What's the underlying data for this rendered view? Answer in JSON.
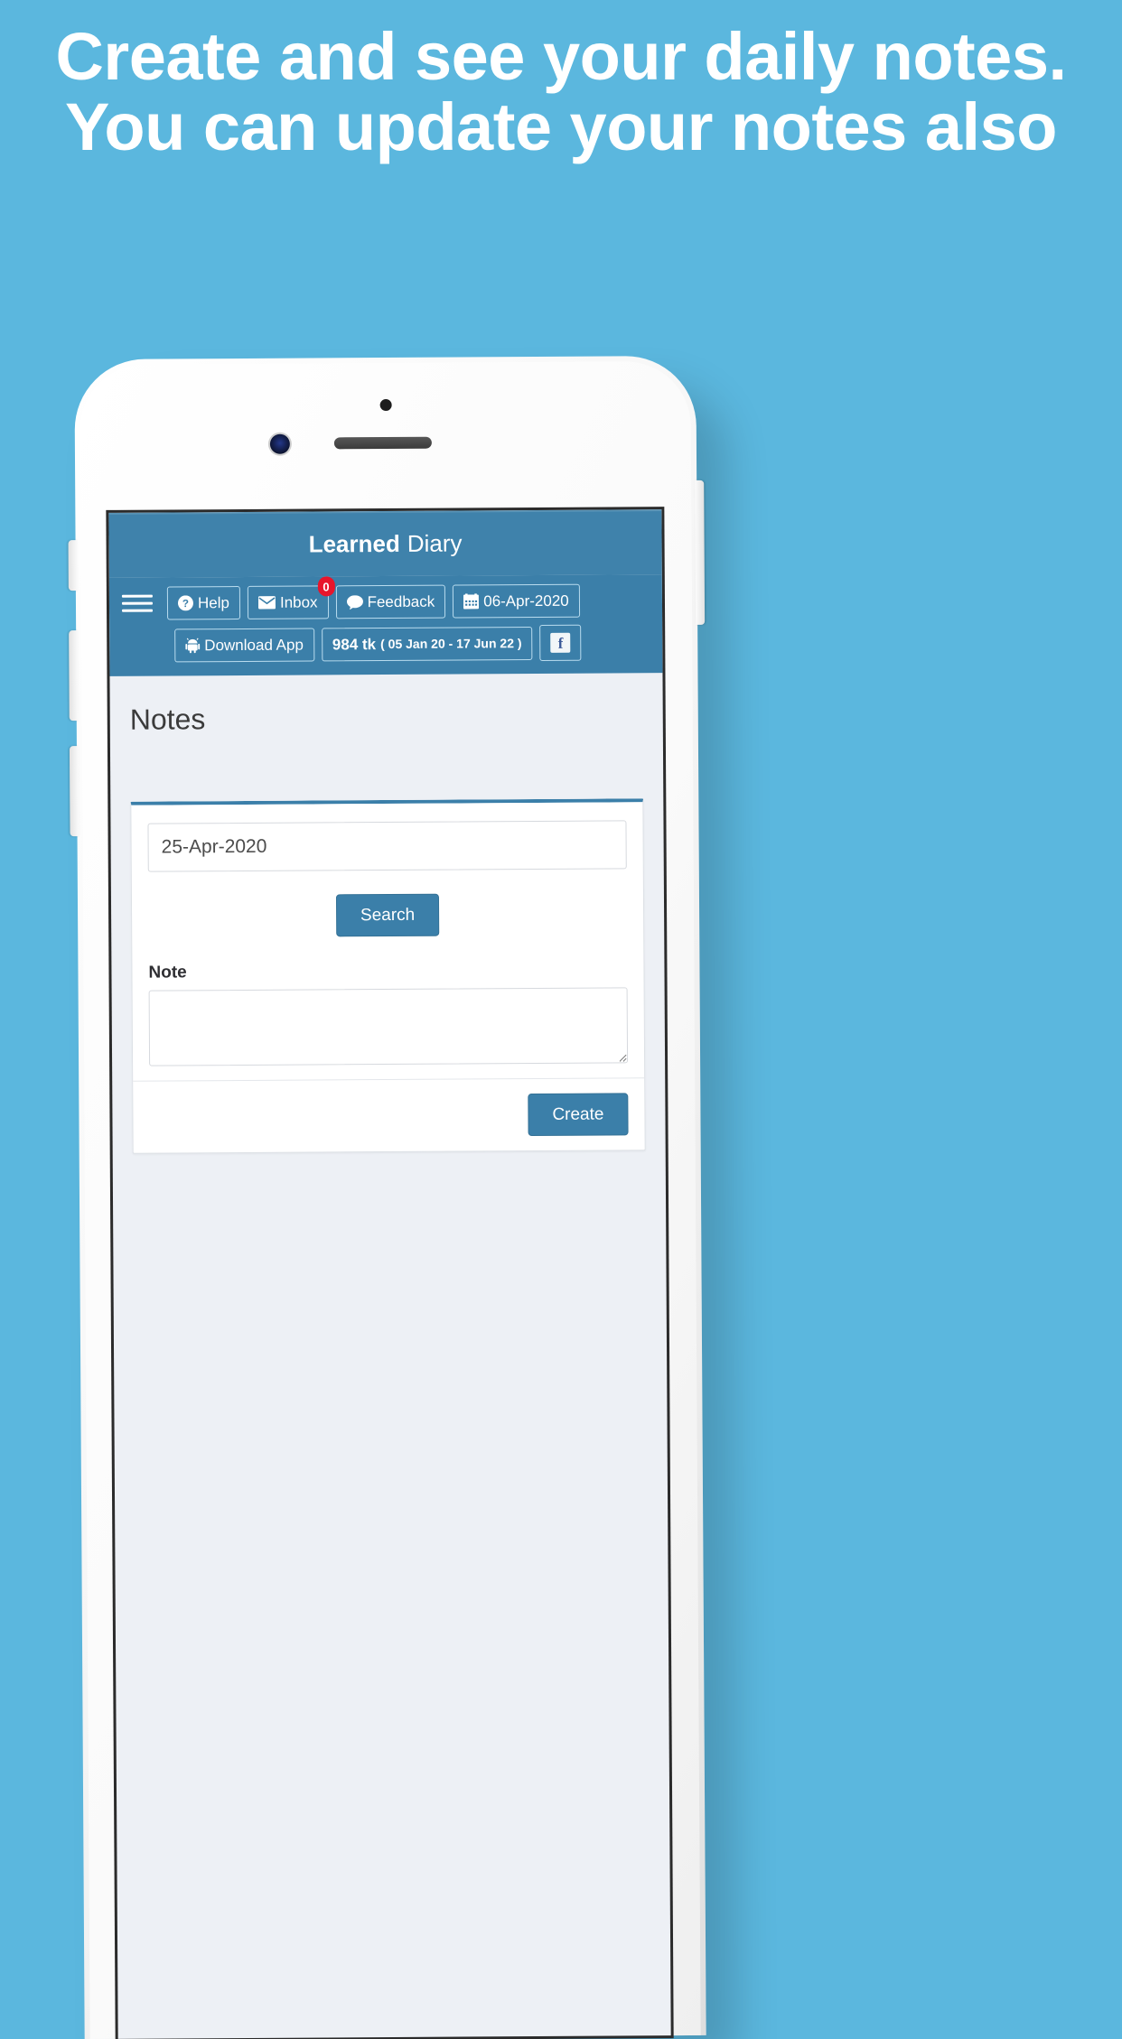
{
  "promo": {
    "headline": "Create and see your daily notes. You can update your notes also",
    "background_color": "#5bb7de",
    "text_color": "#ffffff"
  },
  "app": {
    "brand_bold": "Learned",
    "brand_light": "Diary",
    "accent_color": "#3b7fa9",
    "page_title": "Notes"
  },
  "navbar": {
    "menu_icon": "hamburger-icon",
    "buttons": [
      {
        "label": "Help",
        "icon": "question-circle-icon"
      },
      {
        "label": "Inbox",
        "icon": "envelope-icon",
        "badge": "0"
      },
      {
        "label": "Feedback",
        "icon": "comment-icon"
      },
      {
        "label": "06-Apr-2020",
        "icon": "calendar-icon"
      }
    ],
    "buttons_row2": [
      {
        "label": "Download App",
        "icon": "android-icon"
      },
      {
        "label": "984 tk",
        "range": "( 05 Jan 20 - 17 Jun 22 )",
        "icon": "none"
      },
      {
        "label": "f",
        "icon": "facebook-icon"
      }
    ]
  },
  "form": {
    "date_value": "25-Apr-2020",
    "date_placeholder": "25-Apr-2020",
    "search_label": "Search",
    "note_label": "Note",
    "note_value": "",
    "note_placeholder": "",
    "create_label": "Create"
  }
}
